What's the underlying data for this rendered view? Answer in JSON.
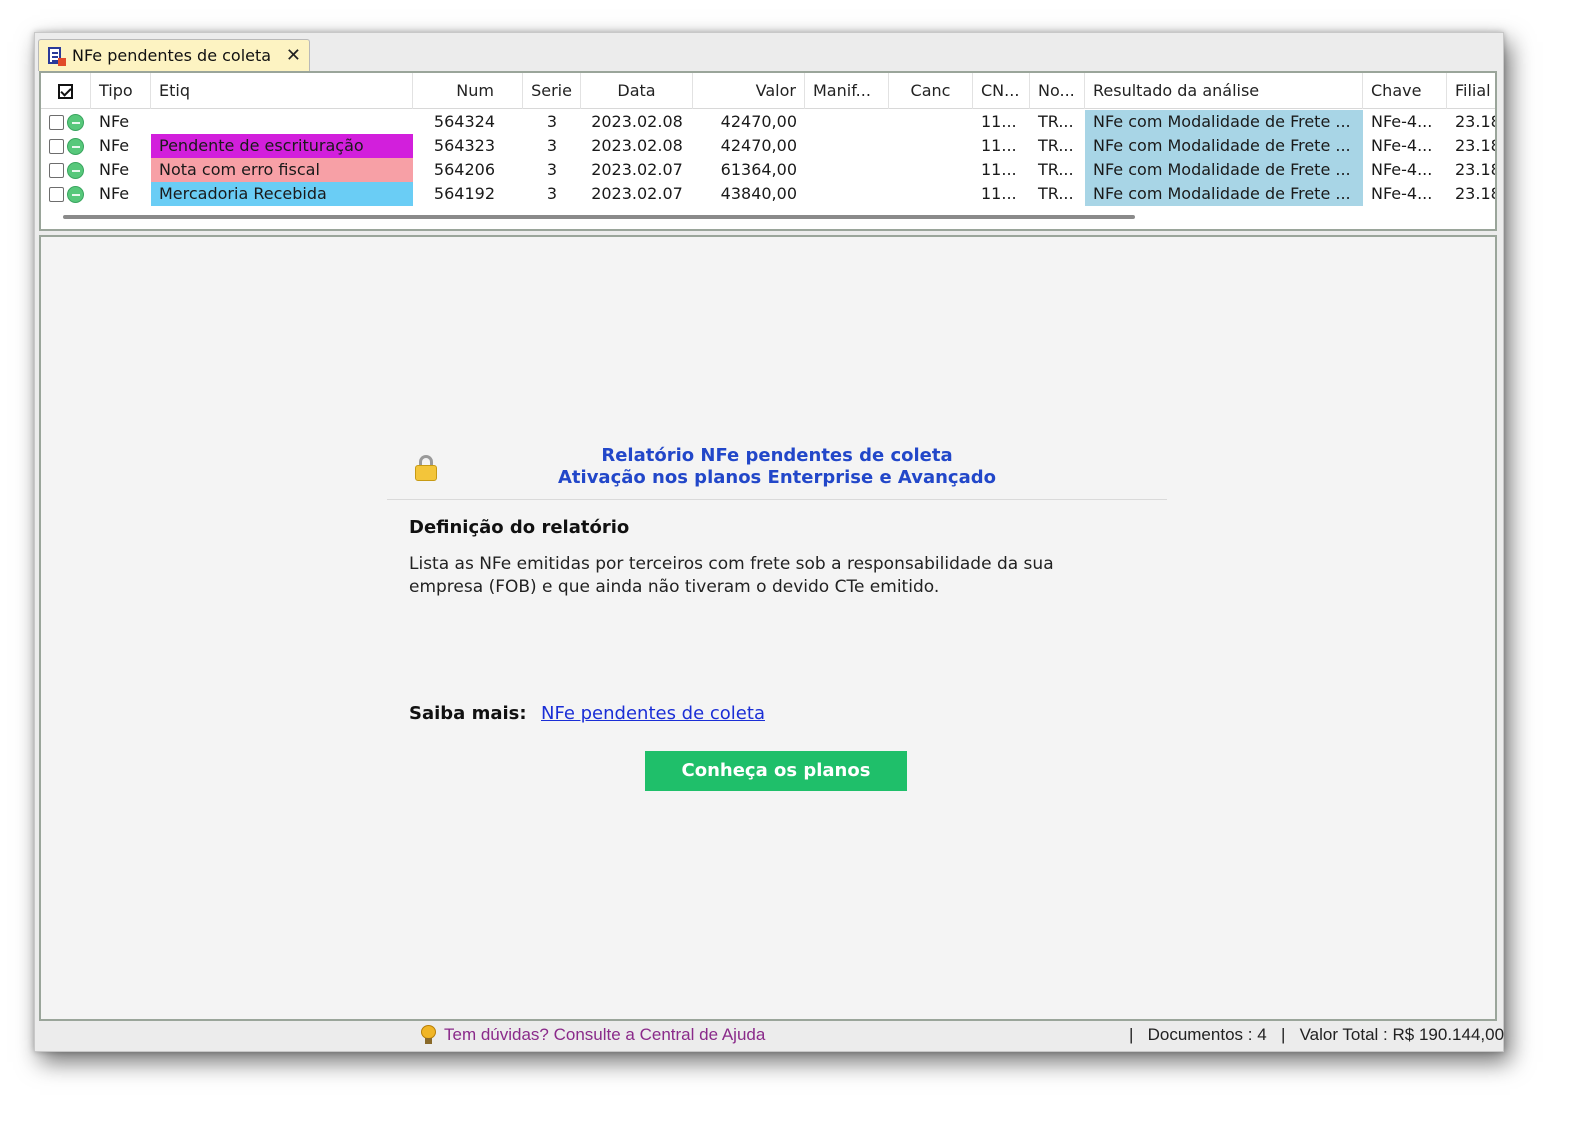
{
  "tab": {
    "label": "NFe pendentes de coleta",
    "close": "✕"
  },
  "columns": [
    "Tipo",
    "Etiq",
    "Num",
    "Serie",
    "Data",
    "Valor",
    "Manif...",
    "Canc",
    "CN...",
    "No...",
    "Resultado da análise",
    "Chave",
    "Filial"
  ],
  "rows": [
    {
      "tipo": "NFe",
      "etiq": "",
      "etiq_color": "",
      "num": "564324",
      "serie": "3",
      "data": "2023.02.08",
      "valor": "42470,00",
      "manif": "",
      "canc": "",
      "cn": "11...",
      "no": "TR...",
      "resultado": "NFe com Modalidade de Frete ...",
      "chave": "NFe-4...",
      "filial": "23.18"
    },
    {
      "tipo": "NFe",
      "etiq": "Pendente de escrituração",
      "etiq_color": "#d21fdc",
      "num": "564323",
      "serie": "3",
      "data": "2023.02.08",
      "valor": "42470,00",
      "manif": "",
      "canc": "",
      "cn": "11...",
      "no": "TR...",
      "resultado": "NFe com Modalidade de Frete ...",
      "chave": "NFe-4...",
      "filial": "23.18"
    },
    {
      "tipo": "NFe",
      "etiq": "Nota com erro fiscal",
      "etiq_color": "#f7a0a6",
      "num": "564206",
      "serie": "3",
      "data": "2023.02.07",
      "valor": "61364,00",
      "manif": "",
      "canc": "",
      "cn": "11...",
      "no": "TR...",
      "resultado": "NFe com Modalidade de Frete ...",
      "chave": "NFe-4...",
      "filial": "23.18"
    },
    {
      "tipo": "NFe",
      "etiq": "Mercadoria Recebida",
      "etiq_color": "#6acdf5",
      "num": "564192",
      "serie": "3",
      "data": "2023.02.07",
      "valor": "43840,00",
      "manif": "",
      "canc": "",
      "cn": "11...",
      "no": "TR...",
      "resultado": "NFe com Modalidade de Frete ...",
      "chave": "NFe-4...",
      "filial": "23.18"
    }
  ],
  "report": {
    "title_line1": "Relatório NFe pendentes de coleta",
    "title_line2": "Ativação nos planos Enterprise e Avançado",
    "definition_heading": "Definição do relatório",
    "definition_text": "Lista as NFe emitidas por terceiros com frete sob a responsabilidade da sua empresa (FOB) e que ainda não tiveram o devido CTe emitido.",
    "saiba_label": "Saiba mais:",
    "saiba_link": "NFe pendentes de coleta",
    "button": "Conheça os planos"
  },
  "status": {
    "help": "Tem dúvidas? Consulte a Central de Ajuda",
    "documentos": "|   Documentos : 4",
    "valor_total": "|   Valor Total : R$ 190.144,00"
  },
  "colors": {
    "analysis_bg": "#a8d5e6",
    "button_bg": "#1fbf6a",
    "title_blue": "#2247c9",
    "link": "#1a2ed6",
    "help_text": "#8a2a8a"
  }
}
